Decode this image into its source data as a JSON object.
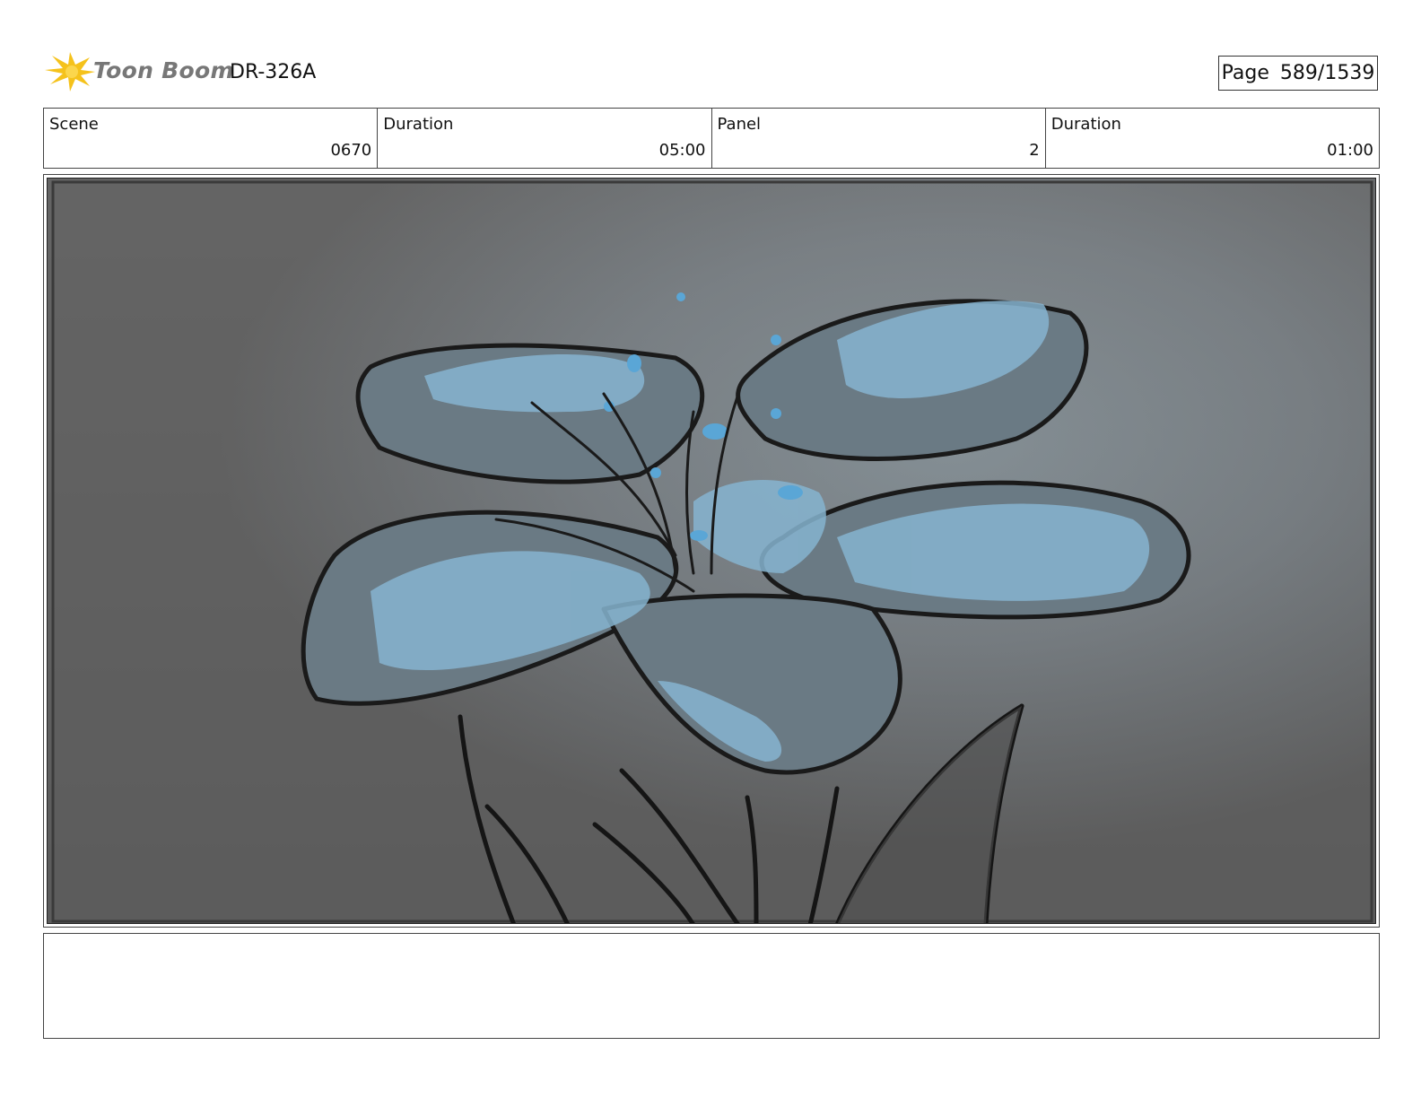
{
  "header": {
    "logo_text": "Toon Boom",
    "doc_id": "DR-326A",
    "page_label": "Page",
    "page_value": "589/1539"
  },
  "info": [
    {
      "label": "Scene",
      "value": "0670"
    },
    {
      "label": "Duration",
      "value": "05:00"
    },
    {
      "label": "Panel",
      "value": "2"
    },
    {
      "label": "Duration",
      "value": "01:00"
    }
  ],
  "colors": {
    "logo_star": "#f5c21b",
    "petal_highlight": "#86b4d0",
    "background_dark": "#555555"
  },
  "panel": {
    "image_description_icon": "flower-sketch-image"
  },
  "notes": {
    "text": ""
  }
}
